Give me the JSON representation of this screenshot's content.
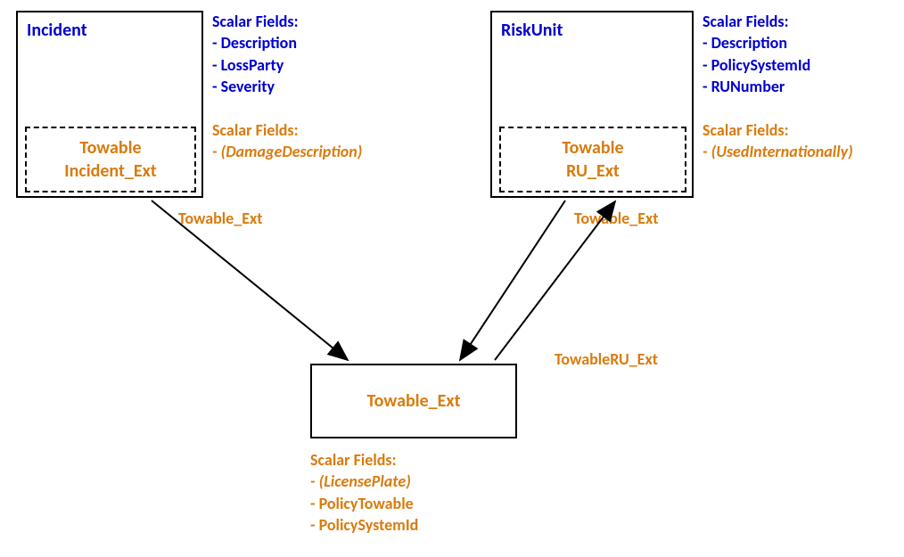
{
  "incident": {
    "title": "Incident",
    "ext_name_line1": "Towable",
    "ext_name_line2": "Incident_Ext",
    "scalar_header": "Scalar Fields:",
    "fields": {
      "f1": "- Description",
      "f2": "- LossParty",
      "f3": "- Severity"
    },
    "ext_scalar_header": "Scalar Fields:",
    "ext_fields": {
      "f1": "- (DamageDescription)"
    }
  },
  "riskunit": {
    "title": "RiskUnit",
    "ext_name_line1": "Towable",
    "ext_name_line2": "RU_Ext",
    "scalar_header": "Scalar Fields:",
    "fields": {
      "f1": "- Description",
      "f2": "- PolicySystemId",
      "f3": "- RUNumber"
    },
    "ext_scalar_header": "Scalar Fields:",
    "ext_fields": {
      "f1": "- (UsedInternationally)"
    }
  },
  "towable": {
    "title": "Towable_Ext",
    "scalar_header": "Scalar Fields:",
    "fields": {
      "f1": "- (LicensePlate)",
      "f2": "- PolicyTowable",
      "f3": "- PolicySystemId"
    }
  },
  "relationships": {
    "incident_to_towable": "Towable_Ext",
    "riskunit_to_towable": "Towable_Ext",
    "towable_to_riskunit": "TowableRU_Ext"
  }
}
